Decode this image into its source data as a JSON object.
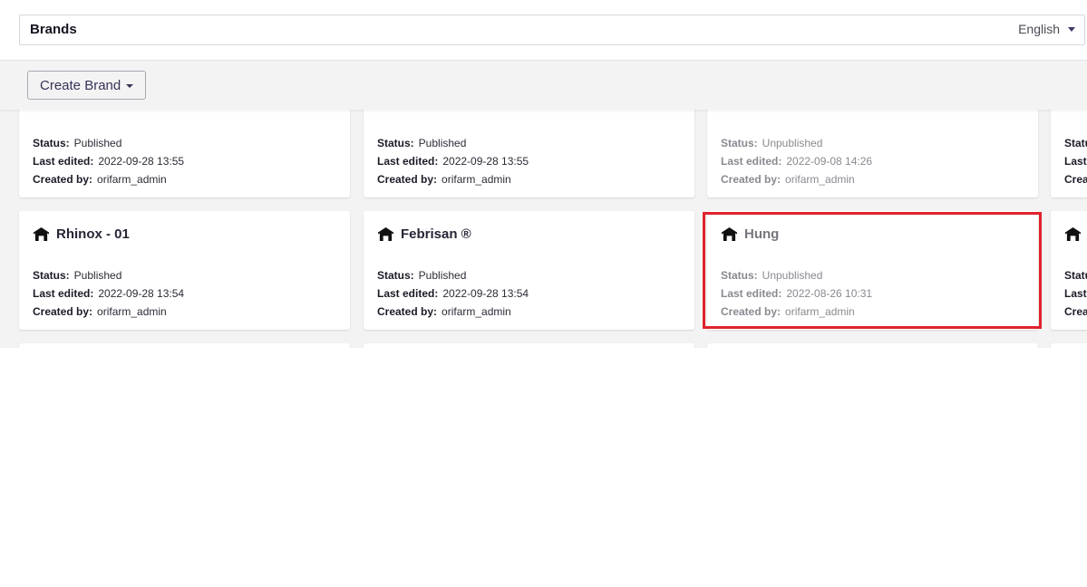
{
  "header": {
    "title": "Brands",
    "language": "English"
  },
  "toolbar": {
    "create_label": "Create Brand"
  },
  "fields": {
    "status": "Status:",
    "last_edited": "Last edited:",
    "created_by": "Created by:"
  },
  "row1": [
    {
      "name": "",
      "status": "Published",
      "edited": "2022-09-28 13:55",
      "creator": "orifarm_admin"
    },
    {
      "name": "",
      "status": "Published",
      "edited": "2022-09-28 13:55",
      "creator": "orifarm_admin"
    },
    {
      "name": "",
      "status": "Unpublished",
      "edited": "2022-09-08 14:26",
      "creator": "orifarm_admin"
    },
    {
      "name": "",
      "status": "Status",
      "edited": "Last",
      "creator": "Crea"
    }
  ],
  "row2": [
    {
      "name": "Rhinox - 01",
      "status": "Published",
      "edited": "2022-09-28 13:54",
      "creator": "orifarm_admin"
    },
    {
      "name": "Febrisan ®",
      "status": "Published",
      "edited": "2022-09-28 13:54",
      "creator": "orifarm_admin"
    },
    {
      "name": "Hung",
      "status": "Unpublished",
      "edited": "2022-08-26 10:31",
      "creator": "orifarm_admin"
    },
    {
      "name": "",
      "status": "Statu",
      "edited": "Last",
      "creator": "Crea"
    }
  ],
  "colors": {
    "highlight": "#e1222c",
    "accent": "#343457"
  },
  "icons": {
    "brand": "tent-icon",
    "language_caret": "chevron-down-icon",
    "create_caret": "chevron-down-icon"
  }
}
